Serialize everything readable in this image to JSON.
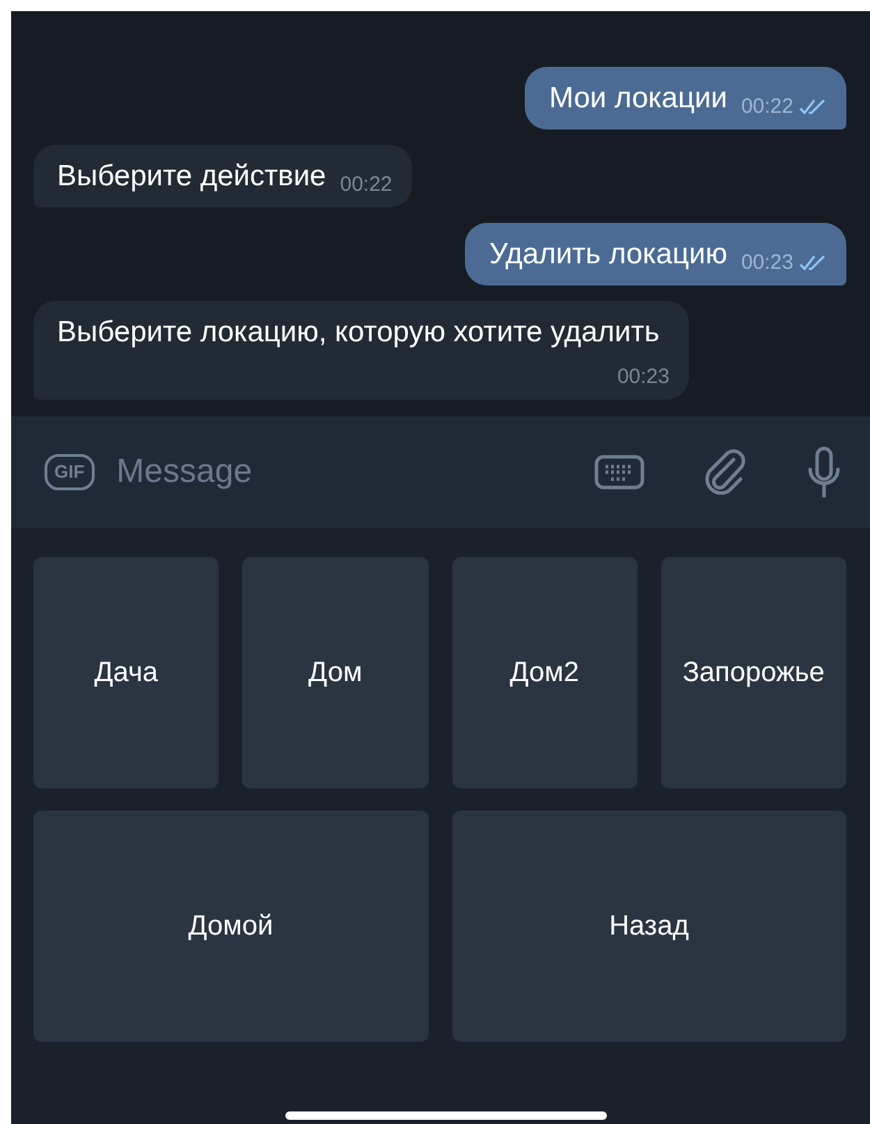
{
  "messages": [
    {
      "kind": "outgoing",
      "text": "Мои локации",
      "time": "00:22"
    },
    {
      "kind": "incoming",
      "text": "Выберите действие",
      "time": "00:22"
    },
    {
      "kind": "outgoing",
      "text": "Удалить локацию",
      "time": "00:23"
    },
    {
      "kind": "incoming",
      "text": "Выберите локацию, которую хотите удалить",
      "time": "00:23"
    }
  ],
  "composer": {
    "gif_label": "GIF",
    "placeholder": "Message"
  },
  "keyboard": {
    "rows": [
      [
        "Дача",
        "Дом",
        "Дом2",
        "Запорожье"
      ],
      [
        "Домой",
        "Назад"
      ]
    ]
  }
}
